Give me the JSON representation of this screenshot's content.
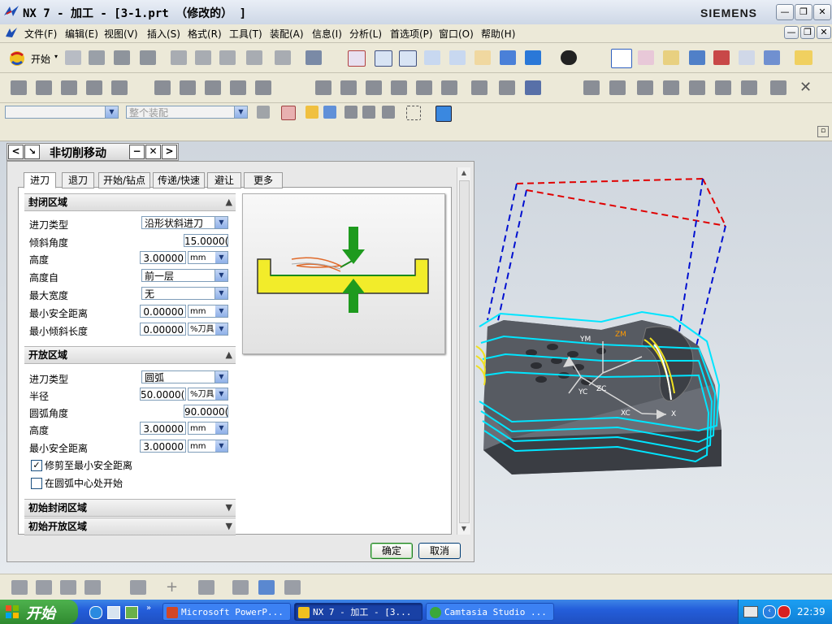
{
  "window": {
    "title": "NX 7 - 加工 - [3-1.prt （修改的） ]",
    "brand": "SIEMENS"
  },
  "menubar": {
    "items": [
      "文件(F)",
      "编辑(E)",
      "视图(V)",
      "插入(S)",
      "格式(R)",
      "工具(T)",
      "装配(A)",
      "信息(I)",
      "分析(L)",
      "首选项(P)",
      "窗口(O)",
      "帮助(H)"
    ]
  },
  "toolbar": {
    "start_label": "开始",
    "filter_placeholder": "整个装配"
  },
  "dialog": {
    "title": "非切削移动",
    "tabs": [
      "进刀",
      "退刀",
      "开始/钻点",
      "传递/快速",
      "避让",
      "更多"
    ],
    "active_tab": "进刀",
    "closed_area": {
      "header": "封闭区域",
      "entry_type_label": "进刀类型",
      "entry_type_value": "沿形状斜进刀",
      "ramp_angle_label": "倾斜角度",
      "ramp_angle_value": "15.0000(",
      "height_label": "高度",
      "height_value": "3.00000",
      "height_unit": "mm",
      "height_from_label": "高度自",
      "height_from_value": "前一层",
      "max_width_label": "最大宽度",
      "max_width_value": "无",
      "min_safe_label": "最小安全距离",
      "min_safe_value": "0.00000",
      "min_safe_unit": "mm",
      "min_ramp_len_label": "最小倾斜长度",
      "min_ramp_len_value": "0.00000",
      "min_ramp_len_unit": "%刀具"
    },
    "open_area": {
      "header": "开放区域",
      "entry_type_label": "进刀类型",
      "entry_type_value": "圆弧",
      "radius_label": "半径",
      "radius_value": "50.0000(",
      "radius_unit": "%刀具",
      "arc_angle_label": "圆弧角度",
      "arc_angle_value": "90.0000(",
      "height_label": "高度",
      "height_value": "3.00000",
      "height_unit": "mm",
      "min_safe_label": "最小安全距离",
      "min_safe_value": "3.00000",
      "min_safe_unit": "mm",
      "trim_label": "修剪至最小安全距离",
      "trim_checked": true,
      "start_center_label": "在圆弧中心处开始",
      "start_center_checked": false
    },
    "initial_closed_header": "初始封闭区域",
    "initial_open_header": "初始开放区域",
    "ok_label": "确定",
    "cancel_label": "取消"
  },
  "viewport": {
    "axis_labels": [
      "YM",
      "ZM",
      "YC",
      "ZC",
      "XC",
      "X"
    ]
  },
  "taskbar": {
    "start_label": "开始",
    "tasks": [
      "Microsoft PowerP...",
      "NX 7 - 加工 - [3...",
      "Camtasia Studio ..."
    ],
    "clock": "22:39"
  },
  "colors": {
    "accent": "#0a246a",
    "taskbar": "#245edb",
    "start_green": "#3c9c3c",
    "part_face": "#5a5e66",
    "toolpath": "#00e5ff",
    "rapid": "#0010d0"
  }
}
